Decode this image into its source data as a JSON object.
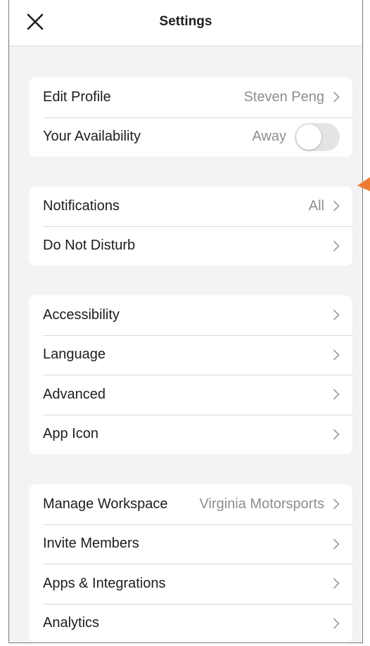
{
  "header": {
    "title": "Settings",
    "close_icon": "close-icon"
  },
  "groups": [
    {
      "rows": [
        {
          "label": "Edit Profile",
          "value": "Steven Peng"
        },
        {
          "label": "Your Availability",
          "value": "Away",
          "toggle_on": false
        }
      ]
    },
    {
      "rows": [
        {
          "label": "Notifications",
          "value": "All"
        },
        {
          "label": "Do Not Disturb",
          "value": ""
        }
      ]
    },
    {
      "rows": [
        {
          "label": "Accessibility"
        },
        {
          "label": "Language"
        },
        {
          "label": "Advanced"
        },
        {
          "label": "App Icon"
        }
      ]
    },
    {
      "rows": [
        {
          "label": "Manage Workspace",
          "value": "Virginia Motorsports"
        },
        {
          "label": "Invite Members"
        },
        {
          "label": "Apps & Integrations"
        },
        {
          "label": "Analytics"
        }
      ]
    }
  ],
  "colors": {
    "background": "#f3f3f3",
    "card": "#ffffff",
    "secondary_text": "#8e8e8e",
    "toggle_off": "#e4e4e4",
    "pointer_accent": "#f07a2d"
  }
}
